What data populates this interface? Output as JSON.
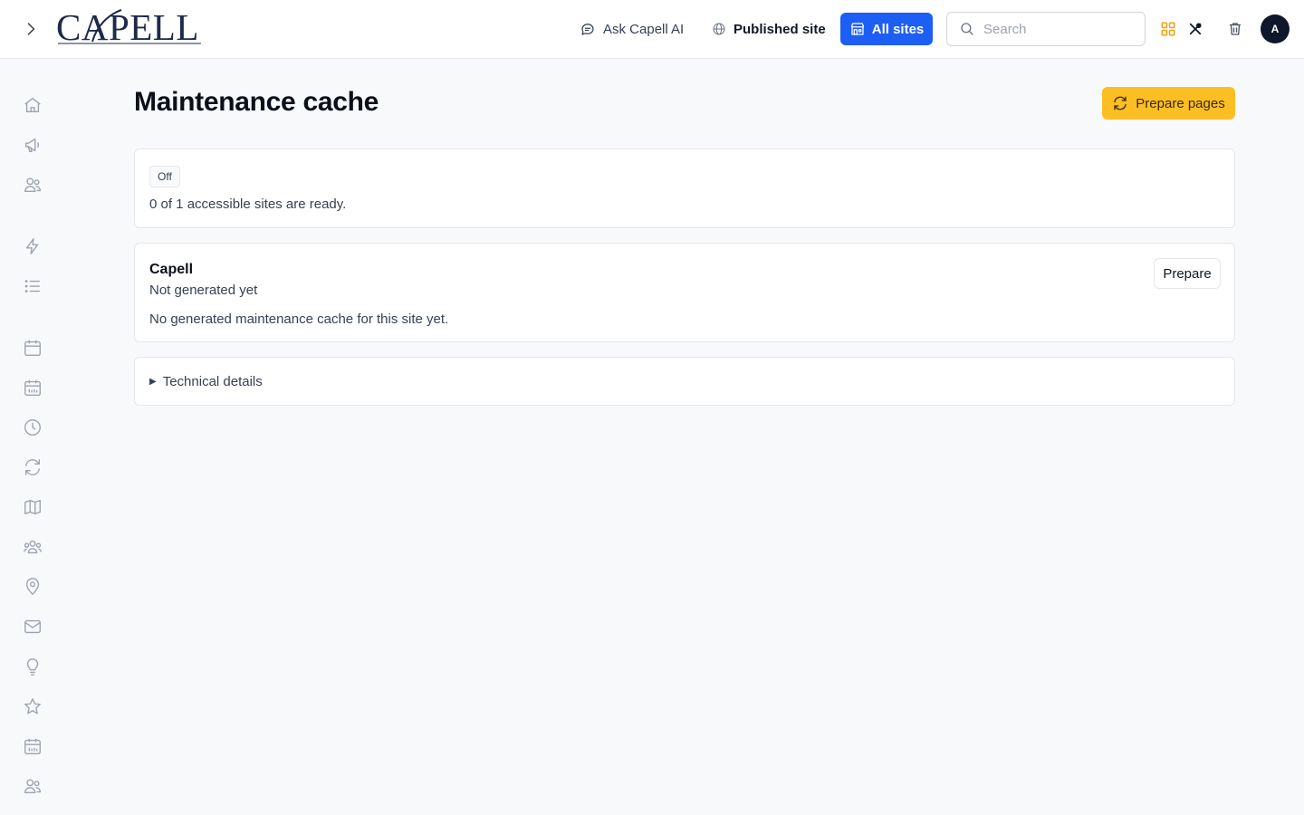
{
  "header": {
    "logo_text": "CAPELL",
    "ask_ai_label": "Ask Capell AI",
    "published_site_label": "Published site",
    "all_sites_label": "All sites",
    "search_placeholder": "Search",
    "avatar_initial": "A",
    "accent_color": "#1d5ef5"
  },
  "sidebar": {
    "icons": [
      "home-icon",
      "megaphone-icon",
      "users-icon",
      "bolt-icon",
      "list-icon",
      "calendar-icon",
      "calendar-days-icon",
      "clock-icon",
      "refresh-icon",
      "map-icon",
      "user-group-icon",
      "map-pin-icon",
      "envelope-icon",
      "lightbulb-icon",
      "star-icon",
      "calendar-days-icon",
      "users-icon"
    ]
  },
  "main": {
    "title": "Maintenance cache",
    "prepare_pages_label": "Prepare pages",
    "status_badge": "Off",
    "status_text": "0 of 1 accessible sites are ready.",
    "site": {
      "name": "Capell",
      "status": "Not generated yet",
      "description": "No generated maintenance cache for this site yet.",
      "prepare_label": "Prepare"
    },
    "details_label": "Technical details",
    "button_color": "#fbbf24"
  }
}
